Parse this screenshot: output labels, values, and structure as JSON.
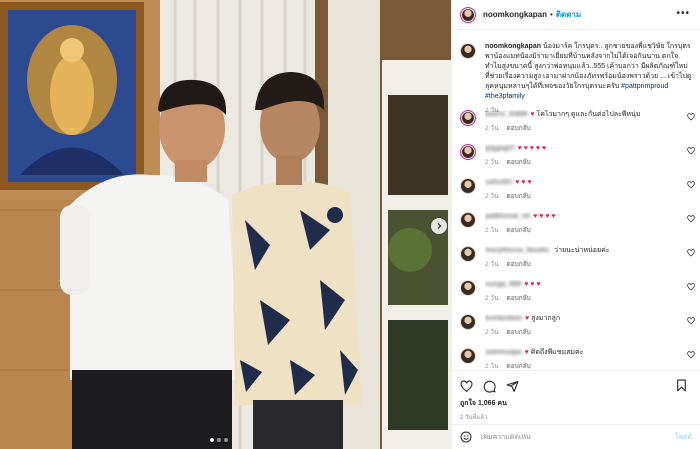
{
  "post": {
    "username": "noomkongkapan",
    "separator": "•",
    "follow_label": "ติดตาม",
    "more_label": "•••",
    "caption_username": "noomkongkapan",
    "caption_text": "น้องมาร์ค ใกรบุตร.. ลูกชายของพี่แชวิษัย ใกรบุตร พาน้องแมทน้องมิร่ามาเยี่ยมที่บ้านหลังจากไม่ได้เจอกันนาน ตกใจทำไมสูงขนาดนี้ สูงกว่าพ่อหนุมแล้ว..555 เค้าบอกว่า มีผลิตภัณฑ์ใหม่ที่ช่วยเรื่องความสูง เอามาฝากน้องภัทรพร้อมน้องพราวด้วย ... เข้าไปดูลุคหนุมหลานๆได้ที่เพจของวัยใกรบุตรนะครับ",
    "caption_tags": "#pattprimproud #the3pfamily",
    "caption_time": "2 วัน"
  },
  "comments": [
    {
      "user": "kaoriz_th888",
      "text": "โคไวมากๆ ดูและกันต่อไปละพี่หนุ่ม",
      "hearts": "♥",
      "time": "2 วัน",
      "reply": "ตอบกลับ"
    },
    {
      "user": "giggagirl",
      "text": "",
      "hearts": "♥ ♥ ♥ ♥ ♥",
      "time": "2 วัน",
      "reply": "ตอบกลับ"
    },
    {
      "user": "salix201",
      "text": "",
      "hearts": "♥ ♥ ♥",
      "time": "2 วัน",
      "reply": "ตอบกลับ"
    },
    {
      "user": "patkhonal_nk",
      "text": "",
      "hearts": "♥ ♥ ♥ ♥",
      "time": "2 วัน",
      "reply": "ตอบกลับ"
    },
    {
      "user": "morpheusa_fanatic",
      "text": "ว่ายนะน่าหน่อยค่ะ",
      "hearts": "",
      "time": "2 วัน",
      "reply": "ตอบกลับ"
    },
    {
      "user": "sunga_888",
      "text": "",
      "hearts": "♥ ♥ ♥",
      "time": "2 วัน",
      "reply": "ตอบกลับ"
    },
    {
      "user": "kunlarakan",
      "text": "สูงมากลูก",
      "hearts": "♥",
      "time": "2 วัน",
      "reply": "ตอบกลับ"
    },
    {
      "user": "sammuapa",
      "text": "คิดถึงพี่แชมสมค่ะ",
      "hearts": "♥",
      "time": "2 วัน",
      "reply": "ตอบกลับ"
    }
  ],
  "footer": {
    "likes": "ถูกใจ 1,066 คน",
    "posted": "2 วันที่แล้ว",
    "add_placeholder": "เพิ่มความคิดเห็น",
    "post_label": "โพสต์"
  },
  "colors": {
    "accent": "#0095f6",
    "heart": "#ed1c50",
    "meta": "#8e8e8e",
    "tag": "#00376b"
  },
  "icons": [
    "more-icon",
    "like-icon",
    "comment-icon",
    "share-icon",
    "save-icon",
    "emoji-icon",
    "carousel-next-icon"
  ]
}
